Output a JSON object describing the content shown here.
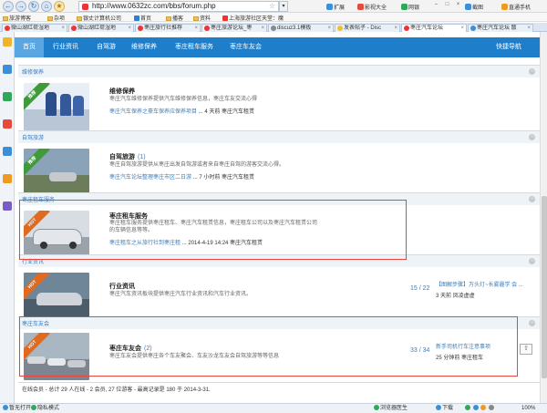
{
  "browser": {
    "url": "http://www.0632zc.com/bbs/forum.php",
    "toolbar": {
      "expand": "扩展",
      "movie": "影视大全",
      "netbank": "网银",
      "screenshot": "截图",
      "tv": "直通手机"
    }
  },
  "bookmarks": [
    "旅游博客",
    "杂项",
    "银丈计算机公司",
    "首页",
    "播客",
    "资料",
    "上海旅游社区天堂：魔"
  ],
  "tabs": [
    {
      "title": "微山湖红荷湿地"
    },
    {
      "title": "微山湖红荷湿地"
    },
    {
      "title": "枣庄旅行社推荐"
    },
    {
      "title": "枣庄旅游论坛_枣"
    },
    {
      "title": "discuz3.1模板"
    },
    {
      "title": "发表帖子 - Disc"
    },
    {
      "title": "枣庄汽车论坛"
    },
    {
      "title": "枣庄汽车论坛 散"
    }
  ],
  "nav": {
    "items": [
      "首页",
      "行业资讯",
      "自驾游",
      "维修保养",
      "枣庄租车服务",
      "枣庄车友会"
    ],
    "quick": "快捷导航"
  },
  "categories": [
    {
      "title": "维修保养",
      "forum": {
        "name": "维修保养",
        "count": "",
        "desc": "枣庄汽车维修保养提供汽车维修保养信息，枣庄车友交流心得",
        "last_link": "枣庄汽车保养之豪车保养应保养项目",
        "last_meta": "... 4 天前 枣庄汽车租赁",
        "ribbon": "推荐"
      }
    },
    {
      "title": "自驾旅游",
      "forum": {
        "name": "自驾旅游",
        "count": "(1)",
        "desc": "枣庄自驾旅游提供从枣庄出发自驾游或者来自枣庄自驾的游客交流心得。",
        "last_link": "枣庄汽车论坛整理枣庄市区二日游",
        "last_meta": "... 7 小时前 枣庄汽车租赁",
        "ribbon": "推荐"
      }
    },
    {
      "title": "枣庄租车服务",
      "forum": {
        "name": "枣庄租车服务",
        "count": "",
        "desc": "枣庄租车服务提供枣庄租车、枣庄汽车租赁信息，枣庄租车公司以及枣庄汽车租赁公司的车辆信息等等。",
        "last_link": "枣庄租车之从旅行社到枣庄租",
        "last_meta": "... 2014-4-19 14:24 枣庄汽车租赁",
        "ribbon": "HOT"
      }
    },
    {
      "title": "行业资讯",
      "forum": {
        "name": "行业资讯",
        "count": "",
        "desc": "枣庄汽车资讯板块提供枣庄汽车行业资讯和汽车行业资讯。",
        "stat": "15 / 22",
        "latest_title": "【图解步骤】万头灯~长雾霾学 会 ...",
        "latest_meta": "3 天前 凤凌虚虚",
        "ribbon": "HOT"
      }
    },
    {
      "title": "枣庄车友会",
      "forum": {
        "name": "枣庄车友会",
        "count": "(2)",
        "desc": "枣庄车友会提供枣庄各个车友聚会、车友沙龙车友会自驾旅游等等信息",
        "stat": "33 / 34",
        "latest_title": "新手司机行车注意事项",
        "latest_meta": "25 分钟前 枣庄租车",
        "ribbon": "HOT"
      }
    }
  ],
  "footer": "在线会员 - 总计 29 人在线 - 2 会员, 27 位游客 - 最高记录是 180 于 2014-3-31.",
  "status": {
    "left1": "暂无打开",
    "left2": "隐私模式",
    "right1": "浏览器医生",
    "right2": "下载",
    "zoom": "100%"
  },
  "colors": {
    "nav_bg": "#1f7ec9",
    "link": "#3a7dc0",
    "highlight": "#e8453c",
    "ribbon_green": "#3f9a3a",
    "ribbon_orange": "#e06a20"
  }
}
